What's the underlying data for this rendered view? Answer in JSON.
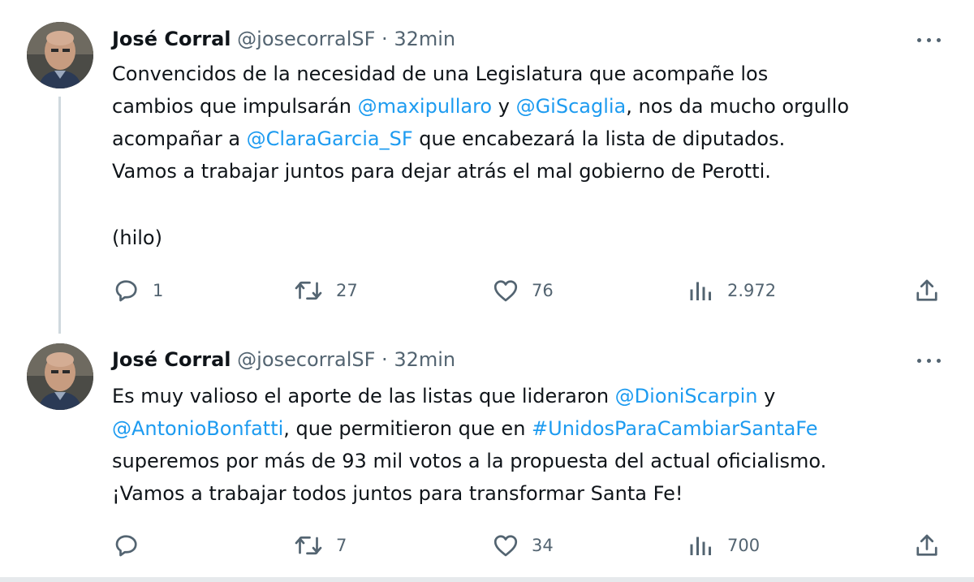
{
  "tweets": [
    {
      "author": {
        "name": "José Corral",
        "handle": "@josecorralSF",
        "separator": "·",
        "time": "32min"
      },
      "text": {
        "line1": "Convencidos de la necesidad de una Legislatura que acompañe los",
        "line2_pre": "cambios que impulsarán ",
        "mention_1": "@maxipullaro",
        "line2_mid": " y ",
        "mention_2": "@GiScaglia",
        "line2_post": ", nos da mucho orgullo",
        "line3_pre": "acompañar a ",
        "mention_3": "@ClaraGarcia_SF",
        "line3_post": " que encabezará la lista de diputados.",
        "line4": "Vamos a trabajar juntos para dejar atrás el mal gobierno de Perotti.",
        "line5": "(hilo)"
      },
      "stats": {
        "replies": "1",
        "retweets": "27",
        "likes": "76",
        "views": "2.972"
      }
    },
    {
      "author": {
        "name": "José Corral",
        "handle": "@josecorralSF",
        "separator": "·",
        "time": "32min"
      },
      "text": {
        "line1_pre": "Es muy valioso el aporte de las listas que lideraron ",
        "mention_1": "@DioniScarpin",
        "line1_post": " y",
        "mention_2": "@AntonioBonfatti",
        "line2_mid": ", que permitieron que en ",
        "hashtag_1": "#UnidosParaCambiarSantaFe",
        "line3": "superemos por más de 93 mil votos a la propuesta del actual oficialismo.",
        "line4": "¡Vamos a trabajar todos juntos para transformar Santa Fe!"
      },
      "stats": {
        "replies": "",
        "retweets": "7",
        "likes": "34",
        "views": "700"
      }
    }
  ],
  "icons": {
    "reply": "reply-icon",
    "retweet": "retweet-icon",
    "like": "heart-icon",
    "views": "views-chart-icon",
    "share": "share-icon",
    "more": "more-dots-icon"
  },
  "colors": {
    "link": "#1d9bf0",
    "secondary_text": "#536471",
    "primary_text": "#0f1419",
    "thread_line": "#cfd9de"
  }
}
